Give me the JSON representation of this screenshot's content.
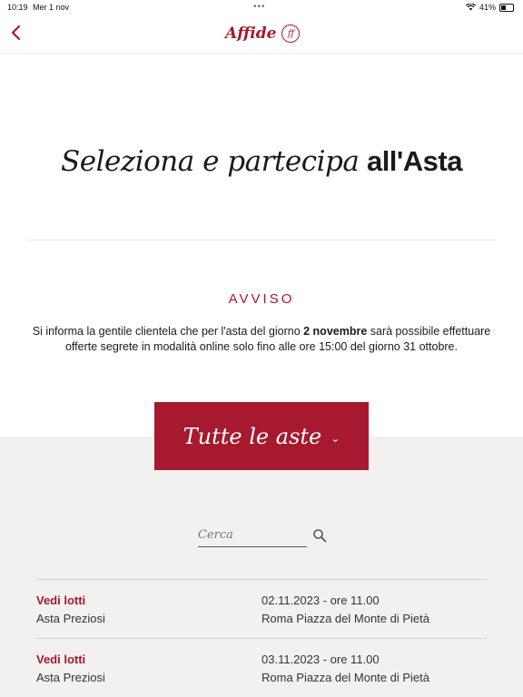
{
  "status_bar": {
    "time": "10:19",
    "date": "Mer 1 nov",
    "battery": "41%",
    "battery_level": 0.41
  },
  "header": {
    "logo_text": "Affide",
    "logo_mark": "ff",
    "back_icon": "chevron-left-icon"
  },
  "headline": {
    "italic": "Seleziona e partecipa",
    "bold": "all'Asta"
  },
  "notice": {
    "title": "AVVISO",
    "text_before": "Si informa la gentile clientela che per l'asta del giorno ",
    "text_bold": "2 novembre",
    "text_after": " sarà possibile effettuare offerte segrete in modalità online solo fino alle ore 15:00 del giorno 31 ottobre."
  },
  "cta": {
    "label": "Tutte le aste",
    "icon": "chevron-down-icon"
  },
  "search": {
    "placeholder": "Cerca",
    "value": "",
    "icon": "search-icon"
  },
  "auctions": [
    {
      "link": "Vedi lotti",
      "type": "Asta Preziosi",
      "date": "02.11.2023 - ore 11.00",
      "place": "Roma Piazza del Monte di Pietà"
    },
    {
      "link": "Vedi lotti",
      "type": "Asta Preziosi",
      "date": "03.11.2023 - ore 11.00",
      "place": "Roma Piazza del Monte di Pietà"
    }
  ],
  "colors": {
    "accent": "#a6192e",
    "background_gray": "#f3f1f0"
  }
}
